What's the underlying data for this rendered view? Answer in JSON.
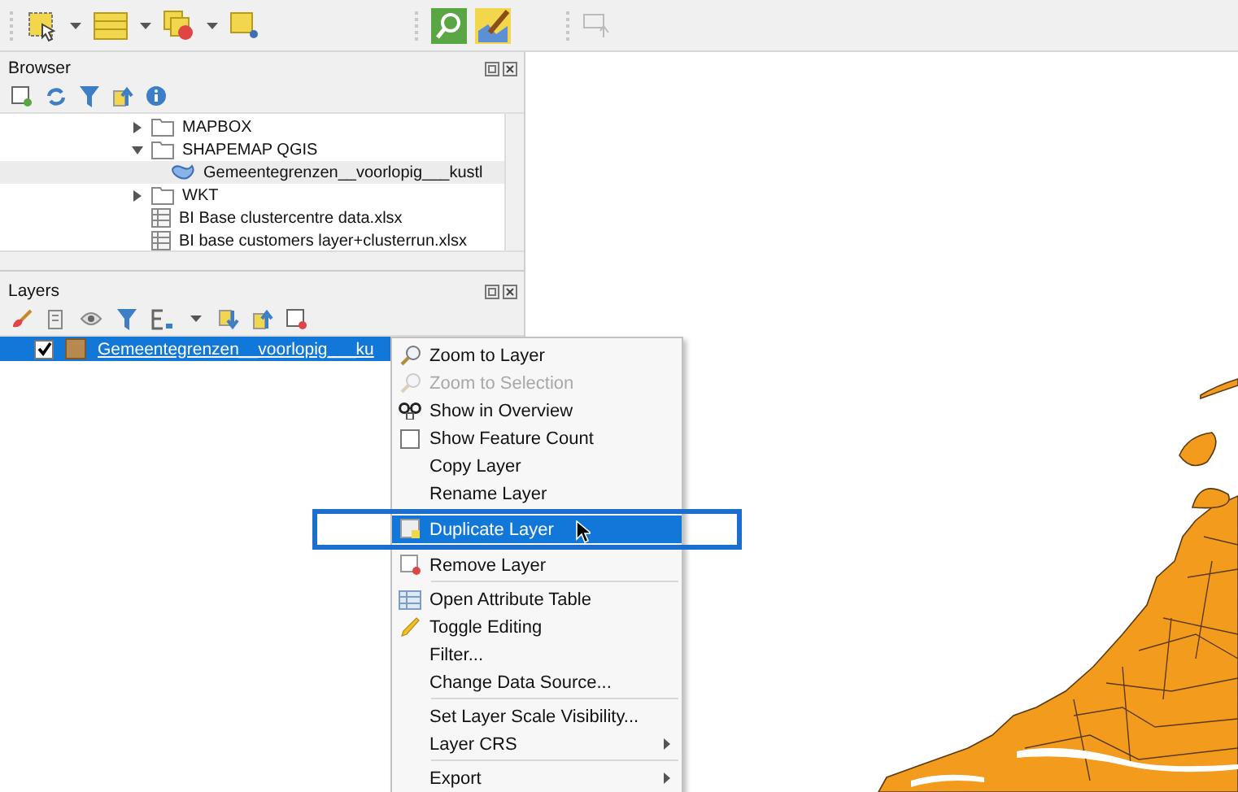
{
  "browser": {
    "title": "Browser",
    "items": [
      {
        "label": "MAPBOX",
        "kind": "folder",
        "expanded": false
      },
      {
        "label": "SHAPEMAP QGIS",
        "kind": "folder",
        "expanded": true,
        "children": [
          {
            "label": "Gemeentegrenzen__voorlopig___kustl",
            "kind": "vector",
            "selected": true
          }
        ]
      },
      {
        "label": "WKT",
        "kind": "folder",
        "expanded": false
      },
      {
        "label": "BI Base clustercentre data.xlsx",
        "kind": "sheet"
      },
      {
        "label": "BI base customers layer+clusterrun.xlsx",
        "kind": "sheet"
      }
    ]
  },
  "layers": {
    "title": "Layers",
    "items": [
      {
        "label": "Gemeentegrenzen__voorlopig___ku",
        "checked": true,
        "selected": true,
        "color": "#b8894e"
      }
    ]
  },
  "context_menu": {
    "items": [
      {
        "label": "Zoom to Layer",
        "kind": "zoom",
        "disabled": false,
        "selected": false
      },
      {
        "label": "Zoom to Selection",
        "kind": "zoom",
        "disabled": true,
        "selected": false
      },
      {
        "label": "Show in Overview",
        "kind": "overview",
        "disabled": false,
        "selected": false
      },
      {
        "label": "Show Feature Count",
        "kind": "checkbox",
        "checked": false,
        "disabled": false,
        "selected": false
      },
      {
        "label": "Copy Layer",
        "kind": "plain",
        "disabled": false,
        "selected": false
      },
      {
        "label": "Rename Layer",
        "kind": "plain",
        "disabled": false,
        "selected": false
      },
      {
        "label": "Duplicate Layer",
        "kind": "duplicate",
        "disabled": false,
        "selected": true
      },
      {
        "label": "Remove Layer",
        "kind": "remove",
        "disabled": false,
        "selected": false
      },
      {
        "kind": "separator"
      },
      {
        "label": "Open Attribute Table",
        "kind": "table",
        "disabled": false,
        "selected": false
      },
      {
        "label": "Toggle Editing",
        "kind": "pencil",
        "disabled": false,
        "selected": false
      },
      {
        "label": "Filter...",
        "kind": "plain",
        "disabled": false,
        "selected": false
      },
      {
        "label": "Change Data Source...",
        "kind": "plain",
        "disabled": false,
        "selected": false
      },
      {
        "kind": "separator"
      },
      {
        "label": "Set Layer Scale Visibility...",
        "kind": "plain",
        "disabled": false,
        "selected": false
      },
      {
        "label": "Layer CRS",
        "kind": "plain",
        "submenu": true,
        "disabled": false,
        "selected": false
      },
      {
        "kind": "separator"
      },
      {
        "label": "Export",
        "kind": "plain",
        "submenu": true,
        "disabled": false,
        "selected": false
      }
    ]
  }
}
